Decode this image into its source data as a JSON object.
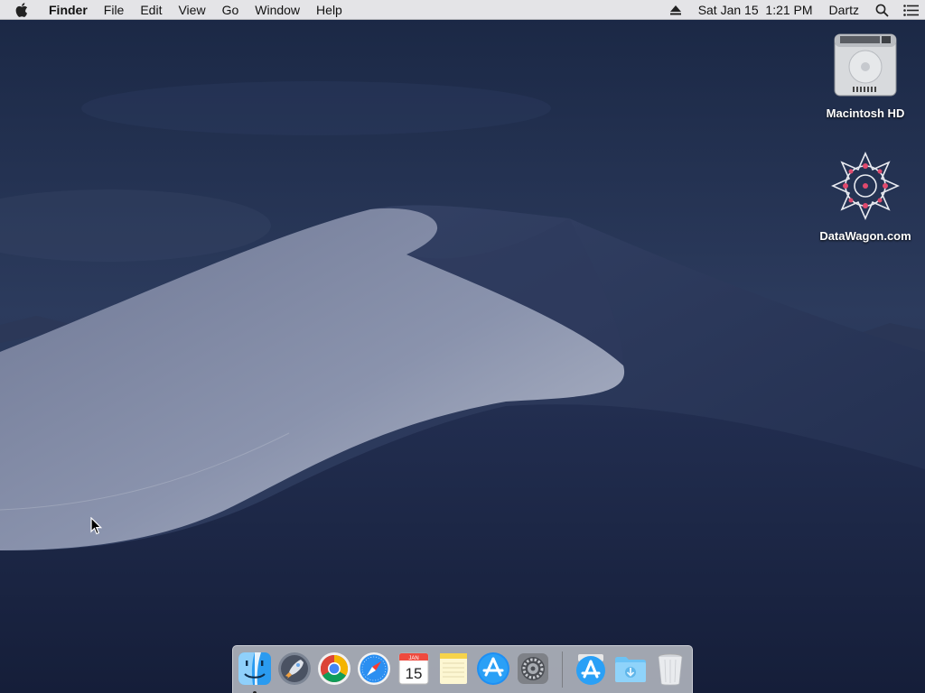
{
  "menubar": {
    "app_name": "Finder",
    "menus": [
      "File",
      "Edit",
      "View",
      "Go",
      "Window",
      "Help"
    ],
    "clock": "Sat Jan 15  1:21 PM",
    "user": "Dartz",
    "icons": [
      "apple-icon",
      "eject-icon",
      "spotlight-search-icon",
      "notification-center-icon"
    ]
  },
  "desktop": {
    "icons": [
      {
        "label": "Macintosh HD",
        "icon": "hard-drive-icon"
      },
      {
        "label": "DataWagon.com",
        "icon": "datawagon-logo-icon"
      }
    ]
  },
  "dock": {
    "apps": [
      {
        "name": "Finder",
        "icon": "finder-icon",
        "running": true
      },
      {
        "name": "Launchpad",
        "icon": "launchpad-icon",
        "running": false
      },
      {
        "name": "Google Chrome",
        "icon": "chrome-icon",
        "running": false
      },
      {
        "name": "Safari",
        "icon": "safari-icon",
        "running": false
      },
      {
        "name": "Calendar",
        "icon": "calendar-icon",
        "running": false,
        "month": "JAN",
        "day": "15"
      },
      {
        "name": "Notes",
        "icon": "notes-icon",
        "running": false
      },
      {
        "name": "App Store",
        "icon": "app-store-icon",
        "running": false
      },
      {
        "name": "System Preferences",
        "icon": "system-preferences-icon",
        "running": false
      }
    ],
    "stack": [
      {
        "name": "App Store",
        "icon": "app-store-stack-icon"
      },
      {
        "name": "Downloads",
        "icon": "downloads-folder-icon"
      },
      {
        "name": "Trash",
        "icon": "trash-icon"
      }
    ]
  },
  "colors": {
    "menubar_bg": "#ececee",
    "sky": "#1e2c4e",
    "dune_light": "#8d97b0",
    "dock_bg": "#d7d9de"
  }
}
